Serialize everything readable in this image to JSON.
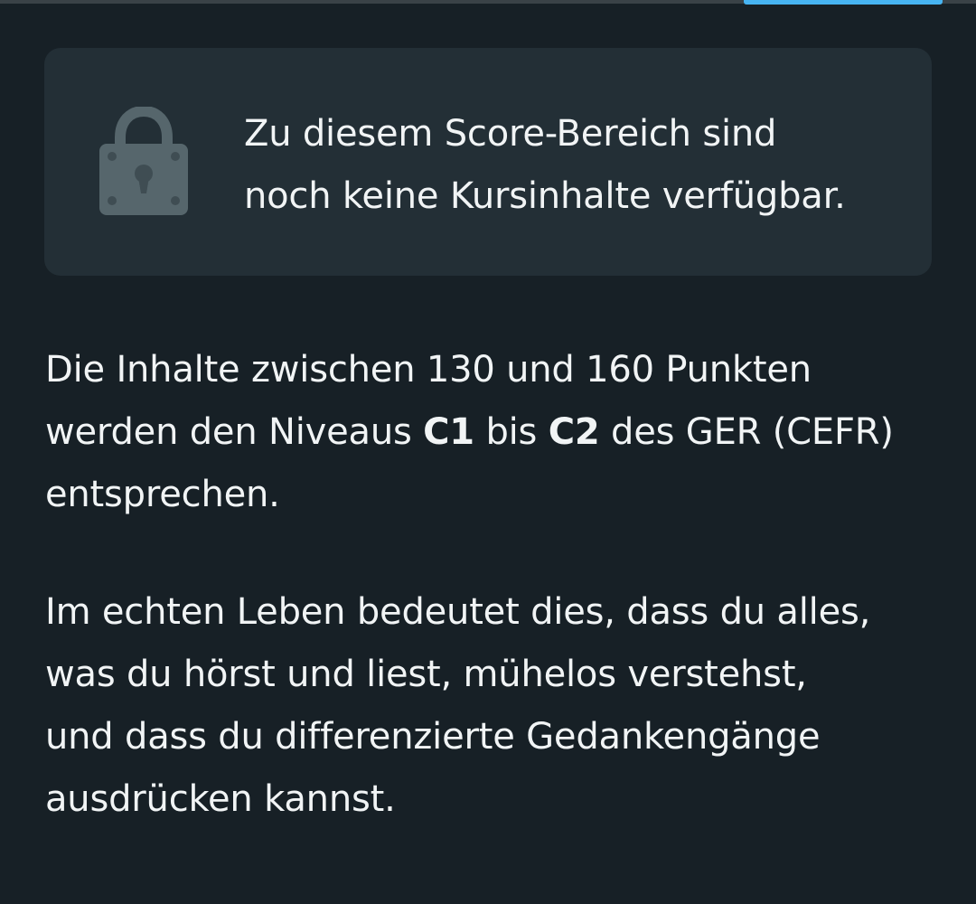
{
  "colors": {
    "background": "#172026",
    "card": "#232f36",
    "text": "#f1f4f5",
    "icon": "#56666c",
    "accent": "#47b4f2"
  },
  "notice": {
    "icon": "lock-icon",
    "message": "Zu diesem Score-Bereich sind\nnoch keine Kursinhalte verfügbar."
  },
  "description": {
    "intro_line_1": "Die Inhalte zwischen 130 und 160 Punkten",
    "intro_prefix": "werden den Niveaus",
    "level_from": "C1",
    "between": "bis",
    "level_to": "C2",
    "framework": "des GER (CEFR)",
    "ending": "entsprechen.",
    "real_life": "Im echten Leben bedeutet dies, dass du alles,\nwas du hörst und liest, mühelos verstehst,\nund dass du differenzierte Gedankengänge\nausdrücken kannst."
  }
}
